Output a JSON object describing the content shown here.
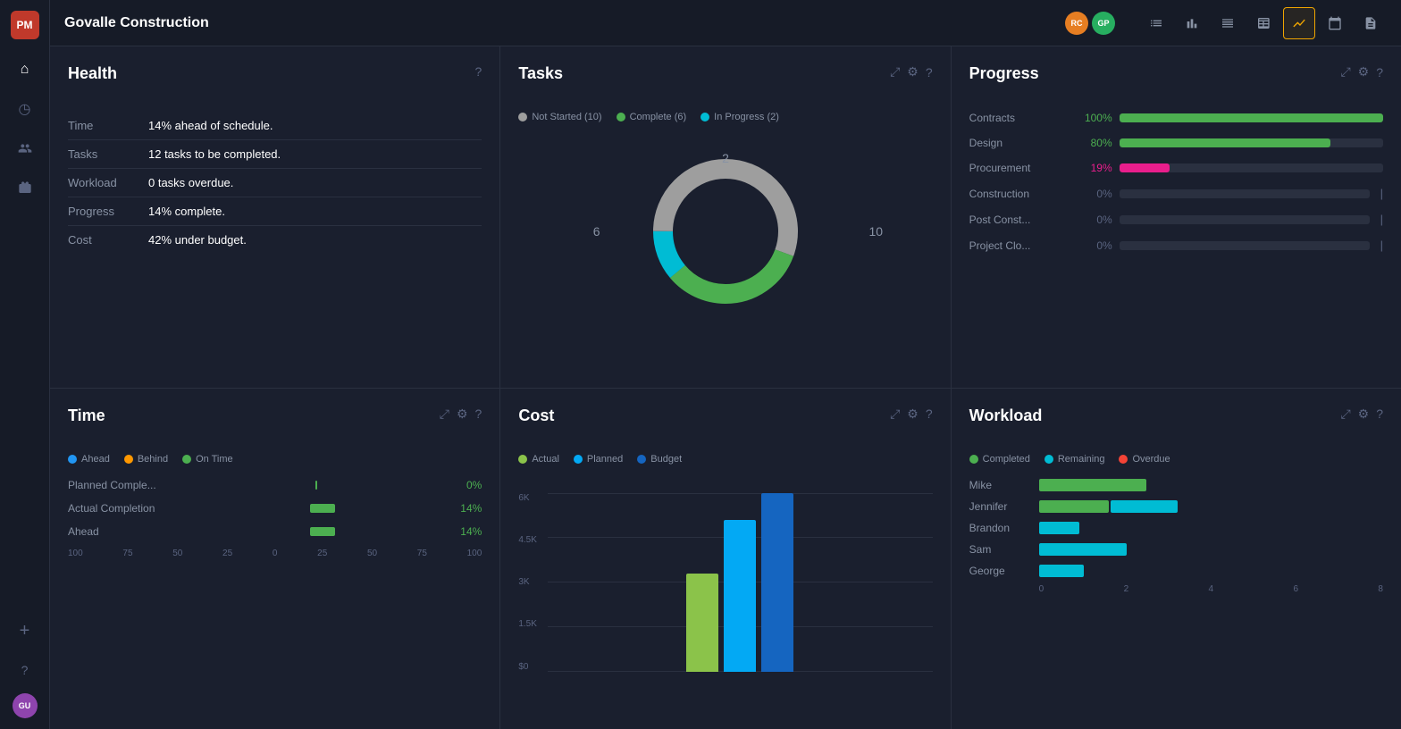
{
  "app": {
    "logo": "PM",
    "title": "Govalle Construction",
    "avatars": [
      {
        "initials": "RC",
        "color": "#e67e22"
      },
      {
        "initials": "GP",
        "color": "#27ae60"
      }
    ]
  },
  "toolbar": {
    "tools": [
      {
        "name": "list-icon",
        "symbol": "≡",
        "active": false
      },
      {
        "name": "bar-chart-icon",
        "symbol": "⦚",
        "active": false
      },
      {
        "name": "align-icon",
        "symbol": "⊟",
        "active": false
      },
      {
        "name": "table-icon",
        "symbol": "⊞",
        "active": false
      },
      {
        "name": "activity-icon",
        "symbol": "∿",
        "active": true
      },
      {
        "name": "calendar-icon",
        "symbol": "📅",
        "active": false
      },
      {
        "name": "doc-icon",
        "symbol": "📄",
        "active": false
      }
    ]
  },
  "sidebar": {
    "items": [
      {
        "name": "home-icon",
        "symbol": "⌂",
        "active": false
      },
      {
        "name": "clock-icon",
        "symbol": "◷",
        "active": false
      },
      {
        "name": "people-icon",
        "symbol": "👤",
        "active": false
      },
      {
        "name": "portfolio-icon",
        "symbol": "💼",
        "active": false
      }
    ],
    "bottom": [
      {
        "name": "plus-icon",
        "symbol": "+"
      },
      {
        "name": "help-icon",
        "symbol": "?"
      },
      {
        "name": "user-avatar",
        "initials": "GU",
        "color": "#8e44ad"
      }
    ]
  },
  "health": {
    "title": "Health",
    "help_icon": "?",
    "rows": [
      {
        "label": "Time",
        "value": "14% ahead of schedule."
      },
      {
        "label": "Tasks",
        "value": "12 tasks to be completed."
      },
      {
        "label": "Workload",
        "value": "0 tasks overdue."
      },
      {
        "label": "Progress",
        "value": "14% complete."
      },
      {
        "label": "Cost",
        "value": "42% under budget."
      }
    ]
  },
  "tasks": {
    "title": "Tasks",
    "legend": [
      {
        "label": "Not Started (10)",
        "color": "#9e9e9e"
      },
      {
        "label": "Complete (6)",
        "color": "#4caf50"
      },
      {
        "label": "In Progress (2)",
        "color": "#00bcd4"
      }
    ],
    "donut": {
      "not_started": 10,
      "complete": 6,
      "in_progress": 2,
      "total": 18,
      "label_left": "6",
      "label_right": "10",
      "label_top": "2"
    }
  },
  "progress": {
    "title": "Progress",
    "rows": [
      {
        "label": "Contracts",
        "pct": 100,
        "pct_label": "100%",
        "color": "#4caf50",
        "pct_color": "green"
      },
      {
        "label": "Design",
        "pct": 80,
        "pct_label": "80%",
        "color": "#4caf50",
        "pct_color": "green"
      },
      {
        "label": "Procurement",
        "pct": 19,
        "pct_label": "19%",
        "color": "#e91e8c",
        "pct_color": "pink"
      },
      {
        "label": "Construction",
        "pct": 0,
        "pct_label": "0%",
        "color": "#4caf50",
        "pct_color": "gray"
      },
      {
        "label": "Post Const...",
        "pct": 0,
        "pct_label": "0%",
        "color": "#4caf50",
        "pct_color": "gray"
      },
      {
        "label": "Project Clo...",
        "pct": 0,
        "pct_label": "0%",
        "color": "#4caf50",
        "pct_color": "gray"
      }
    ]
  },
  "time": {
    "title": "Time",
    "legend": [
      {
        "label": "Ahead",
        "color": "#2196f3"
      },
      {
        "label": "Behind",
        "color": "#ff9800"
      },
      {
        "label": "On Time",
        "color": "#4caf50"
      }
    ],
    "rows": [
      {
        "label": "Planned Comple...",
        "pct_label": "0%",
        "pct": 0,
        "color": "#4caf50"
      },
      {
        "label": "Actual Completion",
        "pct_label": "14%",
        "pct": 14,
        "color": "#4caf50"
      },
      {
        "label": "Ahead",
        "pct_label": "14%",
        "pct": 14,
        "color": "#4caf50"
      }
    ],
    "axis": [
      "100",
      "75",
      "50",
      "25",
      "0",
      "25",
      "50",
      "75",
      "100"
    ]
  },
  "cost": {
    "title": "Cost",
    "legend": [
      {
        "label": "Actual",
        "color": "#8bc34a"
      },
      {
        "label": "Planned",
        "color": "#03a9f4"
      },
      {
        "label": "Budget",
        "color": "#1565c0"
      }
    ],
    "y_axis": [
      "6K",
      "4.5K",
      "3K",
      "1.5K",
      "$0"
    ],
    "bars": {
      "actual_height": 110,
      "planned_height": 170,
      "budget_height": 210
    }
  },
  "workload": {
    "title": "Workload",
    "legend": [
      {
        "label": "Completed",
        "color": "#4caf50"
      },
      {
        "label": "Remaining",
        "color": "#00bcd4"
      },
      {
        "label": "Overdue",
        "color": "#f44336"
      }
    ],
    "people": [
      {
        "name": "Mike",
        "completed": 120,
        "remaining": 0,
        "overdue": 0
      },
      {
        "name": "Jennifer",
        "completed": 80,
        "remaining": 75,
        "overdue": 0
      },
      {
        "name": "Brandon",
        "completed": 0,
        "remaining": 45,
        "overdue": 0
      },
      {
        "name": "Sam",
        "completed": 0,
        "remaining": 100,
        "overdue": 0
      },
      {
        "name": "George",
        "completed": 0,
        "remaining": 50,
        "overdue": 0
      }
    ],
    "axis": [
      "0",
      "2",
      "4",
      "6",
      "8"
    ]
  }
}
